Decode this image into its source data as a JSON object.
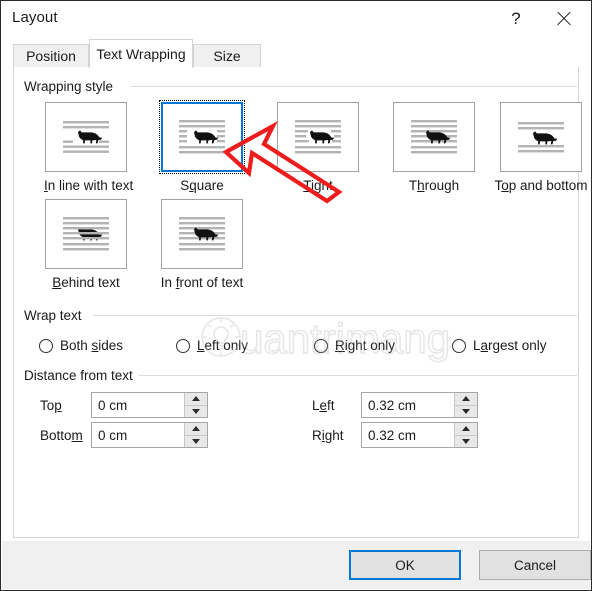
{
  "window": {
    "title": "Layout",
    "help_icon": "question-mark-icon",
    "close_icon": "close-icon"
  },
  "tabs": [
    {
      "label": "Position",
      "active": false
    },
    {
      "label": "Text Wrapping",
      "active": true
    },
    {
      "label": "Size",
      "active": false
    }
  ],
  "wrapping_style": {
    "group_label": "Wrapping style",
    "selected": "Square",
    "options": [
      {
        "label": "In line with text",
        "accel": "I",
        "icon": "wrap-inline-with-text-icon",
        "selected": false
      },
      {
        "label": "Square",
        "accel": "q",
        "icon": "wrap-square-icon",
        "selected": true
      },
      {
        "label": "Tight",
        "accel": "T",
        "icon": "wrap-tight-icon",
        "selected": false
      },
      {
        "label": "Through",
        "accel": "h",
        "icon": "wrap-through-icon",
        "selected": false
      },
      {
        "label": "Top and bottom",
        "accel": "o",
        "icon": "wrap-top-and-bottom-icon",
        "selected": false
      },
      {
        "label": "Behind text",
        "accel": "B",
        "icon": "wrap-behind-text-icon",
        "selected": false
      },
      {
        "label": "In front of text",
        "accel": "f",
        "icon": "wrap-in-front-of-text-icon",
        "selected": false
      }
    ]
  },
  "wrap_text": {
    "group_label": "Wrap text",
    "selected": null,
    "options": [
      {
        "label": "Both sides",
        "accel": "s",
        "checked": false
      },
      {
        "label": "Left only",
        "accel": "L",
        "checked": false
      },
      {
        "label": "Right only",
        "accel": "R",
        "checked": false
      },
      {
        "label": "Largest only",
        "accel": "a",
        "checked": false
      }
    ]
  },
  "distance_from_text": {
    "group_label": "Distance from text",
    "fields": [
      {
        "label": "Top",
        "accel": "p",
        "value": "0 cm"
      },
      {
        "label": "Bottom",
        "accel": "m",
        "value": "0 cm"
      },
      {
        "label": "Left",
        "accel": "e",
        "value": "0.32 cm"
      },
      {
        "label": "Right",
        "accel": "i",
        "value": "0.32 cm"
      }
    ]
  },
  "footer": {
    "ok_label": "OK",
    "cancel_label": "Cancel"
  },
  "annotation": {
    "arrow_color": "#ee1d1d",
    "points_to": "Square",
    "description": "red-arrow-pointing-to-square-option"
  },
  "watermark": {
    "text": "uantrimang",
    "logo": "lightbulb-icon",
    "color": "#b9b9b9"
  },
  "colors": {
    "accent": "#0078d7",
    "dialog_bg": "#ffffff",
    "footer_bg": "#f0f0f0",
    "border": "#d4d4d4",
    "text": "#1b1b1b"
  }
}
